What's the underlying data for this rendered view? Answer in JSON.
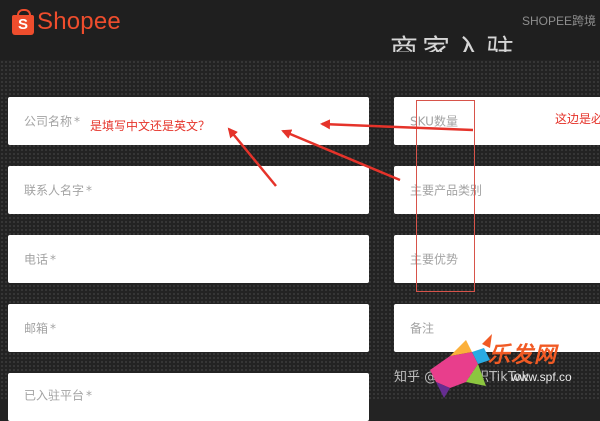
{
  "header": {
    "logo_letter": "S",
    "logo_text": "Shopee",
    "nav_text": "SHOPEE跨境"
  },
  "title_fragment": "商家入驻",
  "form": {
    "left_fields": [
      {
        "label": "公司名称",
        "required": "*"
      },
      {
        "label": "联系人名字",
        "required": "*"
      },
      {
        "label": "电话",
        "required": "*"
      },
      {
        "label": "邮箱",
        "required": "*"
      },
      {
        "label": "已入驻平台",
        "required": "*"
      }
    ],
    "right_fields": [
      {
        "label": "SKU数量"
      },
      {
        "label": "主要产品类别"
      },
      {
        "label": "主要优势"
      },
      {
        "label": "备注"
      }
    ]
  },
  "annotations": {
    "left_note": "是填写中文还是英文？",
    "right_note": "这边是必"
  },
  "watermark": {
    "text": "知乎 @跨境知识TikTok",
    "stamp_text": "乐发网",
    "stamp_sub": "www.spf.co"
  },
  "colors": {
    "brand": "#ee4d2d",
    "annotation": "#e5332a",
    "background": "#232323"
  }
}
